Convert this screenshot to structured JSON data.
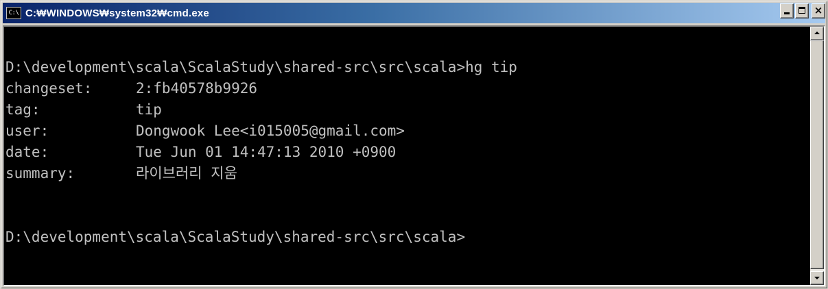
{
  "window": {
    "title": "C:₩WINDOWS₩system32₩cmd.exe",
    "icon_label": "C:\\",
    "icon": "cmd-icon",
    "titlebar_colors": [
      "#0a246a",
      "#a6caf0"
    ]
  },
  "caption_buttons": {
    "minimize": "minimize-icon",
    "maximize": "maximize-icon",
    "close": "close-icon",
    "close_glyph": "×"
  },
  "console": {
    "background": "#000000",
    "foreground": "#c0c0c0",
    "command_line": "D:\\development\\scala\\ScalaStudy\\shared-src\\src\\scala>hg tip",
    "fields": [
      {
        "key": "changeset:",
        "value": "2:fb40578b9926"
      },
      {
        "key": "tag:",
        "value": "tip"
      },
      {
        "key": "user:",
        "value": "Dongwook Lee<i015005@gmail.com>"
      },
      {
        "key": "date:",
        "value": "Tue Jun 01 14:47:13 2010 +0900"
      },
      {
        "key": "summary:",
        "value": "라이브러리 지움"
      }
    ],
    "prompt": "D:\\development\\scala\\ScalaStudy\\shared-src\\src\\scala>"
  },
  "scrollbar": {
    "up": "arrow-up-icon",
    "down": "arrow-down-icon"
  }
}
